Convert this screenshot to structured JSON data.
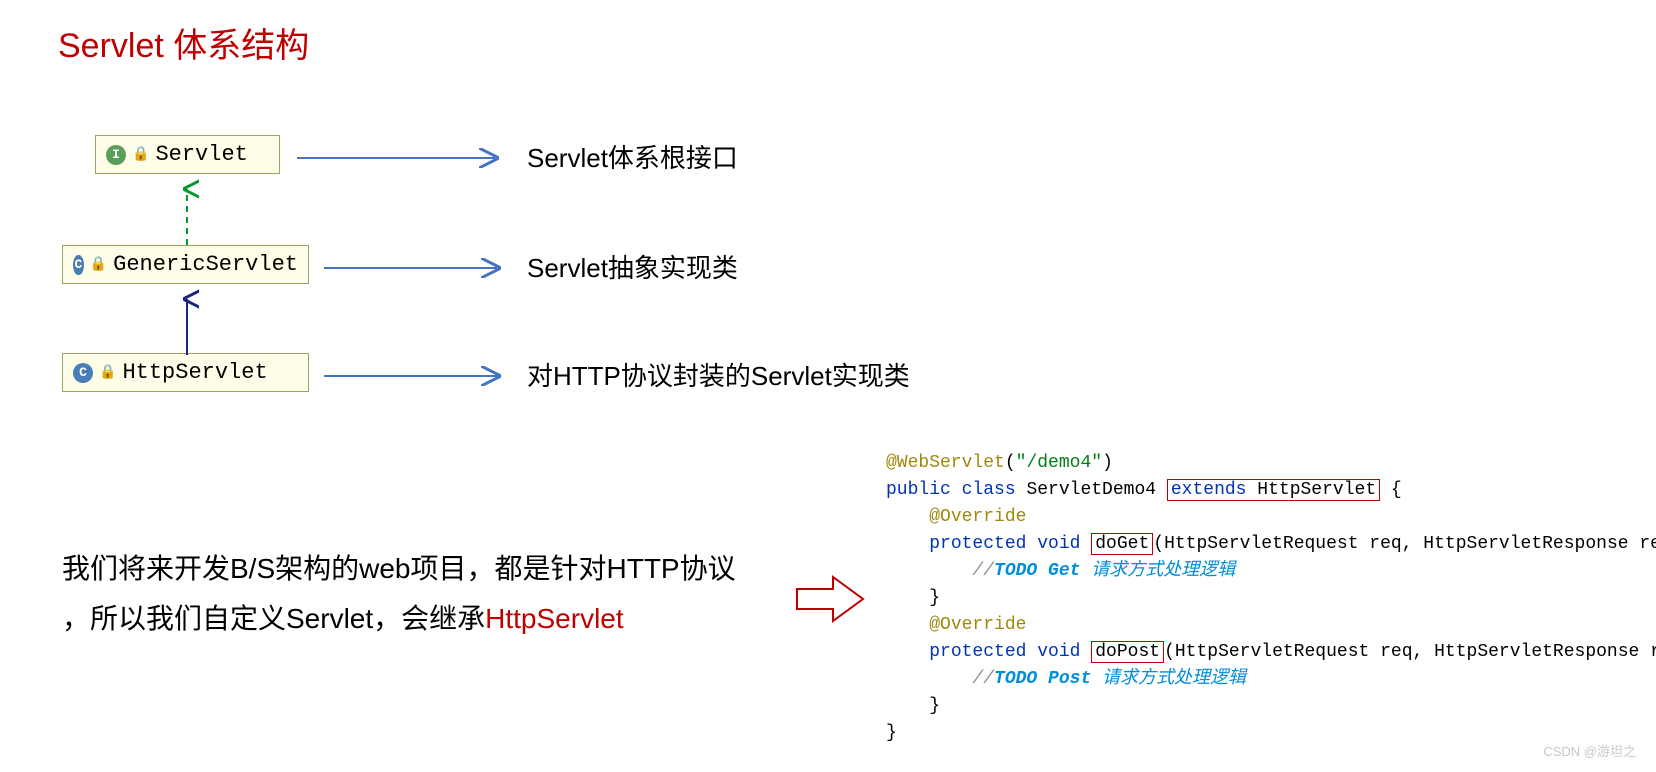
{
  "title": "Servlet 体系结构",
  "uml": {
    "servlet": {
      "label": "Servlet",
      "icon": "I"
    },
    "generic": {
      "label": "GenericServlet",
      "icon": "C"
    },
    "http": {
      "label": "HttpServlet",
      "icon": "C"
    }
  },
  "descriptions": {
    "d1": "Servlet体系根接口",
    "d2": "Servlet抽象实现类",
    "d3": "对HTTP协议封装的Servlet实现类"
  },
  "body": {
    "line1": "我们将来开发B/S架构的web项目，都是针对HTTP协议",
    "line2_a": "，所以我们自定义Servlet，会继承",
    "line2_b": "HttpServlet"
  },
  "code": {
    "l1_anno": "@WebServlet",
    "l1_str": "\"/demo4\"",
    "l2_a": "public class ",
    "l2_b": "ServletDemo4 ",
    "l2_c": "extends ",
    "l2_d": "HttpServlet",
    "l3": "@Override",
    "l4_a": "protected void ",
    "l4_b": "doGet",
    "l4_c": "(HttpServletRequest req, HttpServletResponse resp) ",
    "l5_a": "//",
    "l5_b": "TODO Get ",
    "l5_c": "请求方式处理逻辑",
    "l7": "@Override",
    "l8_a": "protected void ",
    "l8_b": "doPost",
    "l8_c": "(HttpServletRequest req, HttpServletResponse resp)",
    "l9_a": "//",
    "l9_b": "TODO Post ",
    "l9_c": "请求方式处理逻辑",
    "brace_open": " {",
    "brace_close": "}",
    "paren": "(",
    "paren_close": ")"
  },
  "attribution": "CSDN @游坦之"
}
